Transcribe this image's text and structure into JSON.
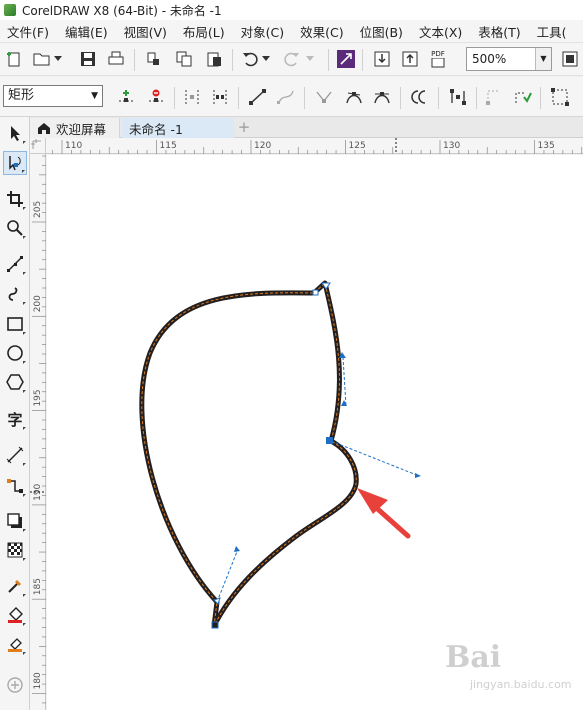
{
  "title": "CorelDRAW X8 (64-Bit) - 未命名 -1",
  "menu": [
    "文件(F)",
    "编辑(E)",
    "视图(V)",
    "布局(L)",
    "对象(C)",
    "效果(C)",
    "位图(B)",
    "文本(X)",
    "表格(T)",
    "工具("
  ],
  "toolbar": {
    "zoom_value": "500%",
    "pdf_label": "PDF"
  },
  "property_bar": {
    "shape_select": "矩形"
  },
  "tabs": [
    "欢迎屏幕",
    "未命名 -1"
  ],
  "tab_add": "+",
  "toolbox": {
    "text_tool_glyph": "字"
  },
  "rulers": {
    "horizontal": [
      "110",
      "115",
      "120",
      "125",
      "130",
      "135"
    ],
    "vertical": [
      "205",
      "200",
      "195",
      "190",
      "185",
      "180"
    ]
  },
  "watermark": {
    "logo": "Bai",
    "text": "jingyan.baidu.com"
  },
  "colors": {
    "accent": "#1e6fc4",
    "path_dark": "#231f20",
    "path_outline": "#e07d1d",
    "annotation_arrow": "#e8403a"
  }
}
